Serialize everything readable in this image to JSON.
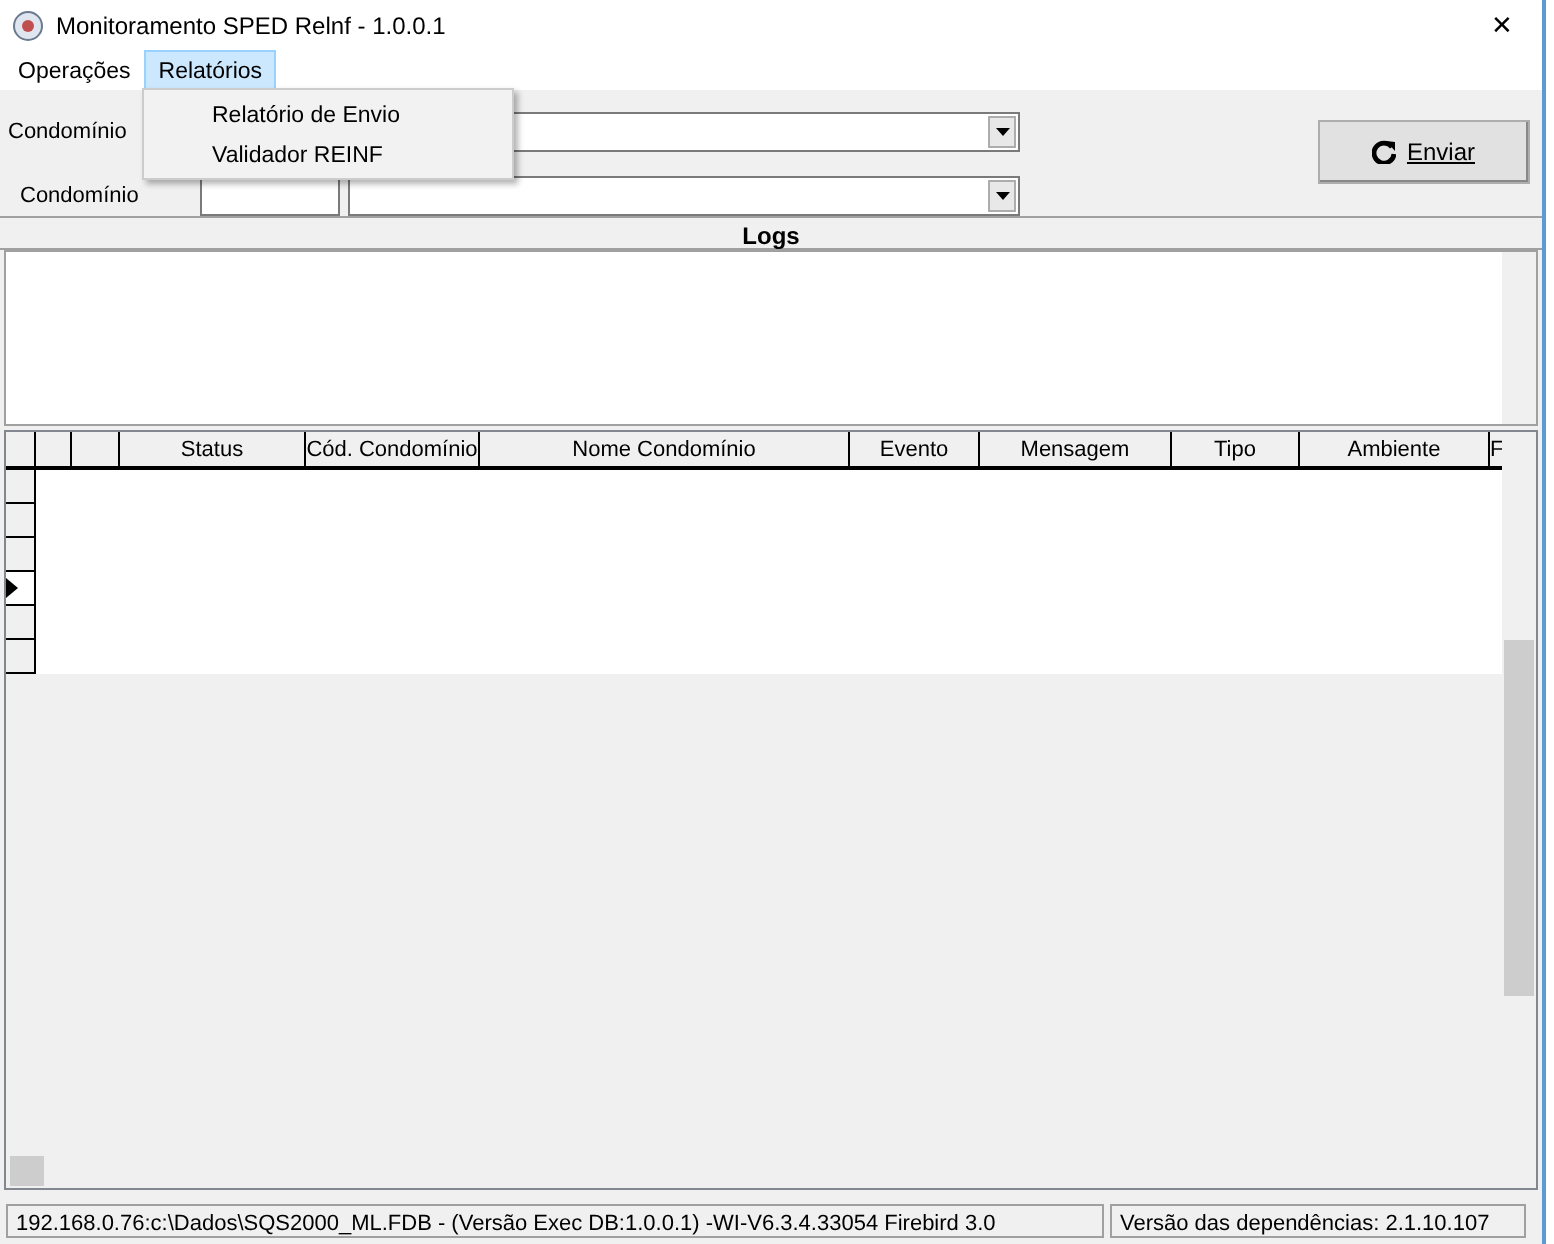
{
  "window": {
    "title": "Monitoramento SPED Relnf - 1.0.0.1",
    "close": "✕"
  },
  "menu": [
    {
      "label": "Operações",
      "selected": false
    },
    {
      "label": "Relatórios",
      "selected": true
    }
  ],
  "dropdown": [
    "Relatório de Envio",
    "Validador REINF"
  ],
  "filters": [
    {
      "label": "Condomínio"
    },
    {
      "label": "Condomínio"
    }
  ],
  "send_button": "Enviar",
  "logs": {
    "title": "Logs"
  },
  "grid": {
    "columns": [
      "",
      "",
      "Status",
      "Cód. Condomínio",
      "Nome Condomínio",
      "Evento",
      "Mensagem",
      "Tipo",
      "Ambiente",
      "F"
    ],
    "rows": [
      {
        "selected": false
      },
      {
        "selected": false
      },
      {
        "selected": false
      },
      {
        "selected": true
      },
      {
        "selected": false
      },
      {
        "selected": false
      }
    ]
  },
  "status_bar": [
    "192.168.0.76:c:\\Dados\\SQS2000_ML.FDB - (Versão Exec DB:1.0.0.1) -WI-V6.3.4.33054 Firebird 3.0",
    "Versão das dependências: 2.1.10.107"
  ]
}
